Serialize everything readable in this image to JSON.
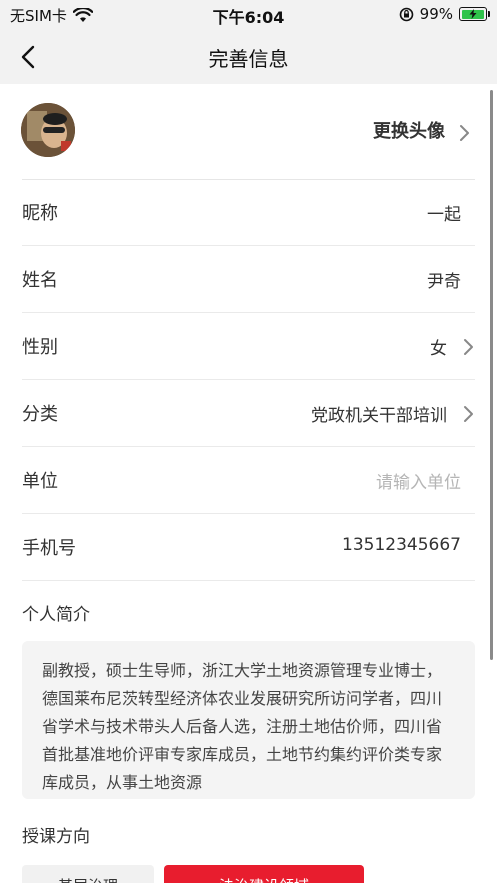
{
  "status_bar": {
    "carrier": "无SIM卡",
    "time": "下午6:04",
    "battery_percent": "99%",
    "battery_level": 0.99
  },
  "nav": {
    "title": "完善信息"
  },
  "avatar_row": {
    "label": "更换头像"
  },
  "fields": {
    "nickname": {
      "label": "昵称",
      "value": "一起"
    },
    "name": {
      "label": "姓名",
      "value": "尹奇"
    },
    "gender": {
      "label": "性别",
      "value": "女"
    },
    "category": {
      "label": "分类",
      "value": "党政机关干部培训"
    },
    "unit": {
      "label": "单位",
      "placeholder": "请输入单位"
    },
    "phone": {
      "label": "手机号",
      "value": "13512345667"
    }
  },
  "bio": {
    "title": "个人简介",
    "text": "副教授，硕士生导师，浙江大学土地资源管理专业博士，德国莱布尼茨转型经济体农业发展研究所访问学者，四川省学术与技术带头人后备人选，注册土地估价师，四川省首批基准地价评审专家库成员，土地节约集约评价类专家库成员，从事土地资源"
  },
  "teaching": {
    "title": "授课方向",
    "tags": [
      "基层治理",
      "法治建设领域"
    ]
  },
  "colors": {
    "accent_red": "#e81d2e",
    "battery_green": "#2fc34a"
  }
}
